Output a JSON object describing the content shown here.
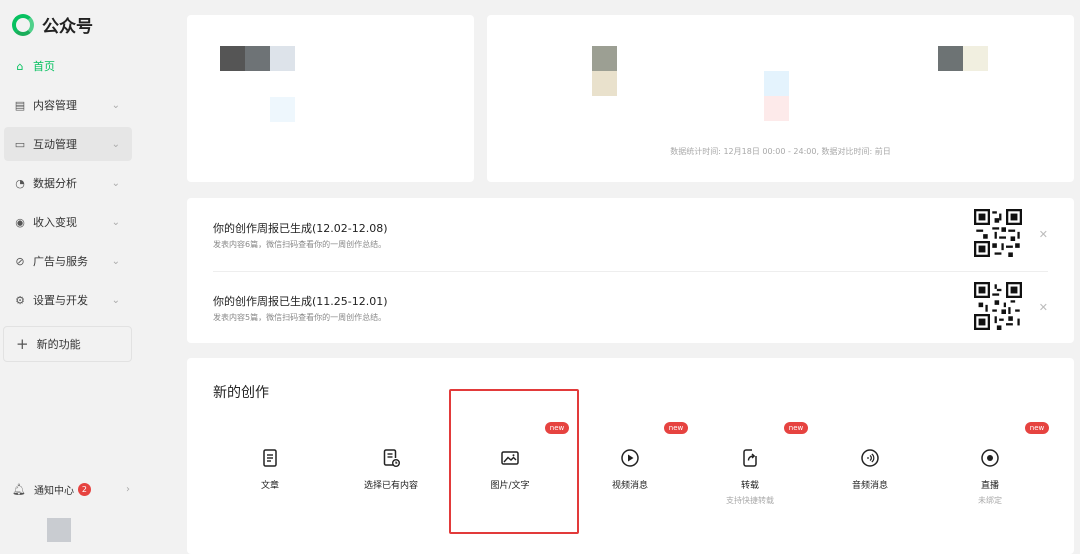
{
  "app": {
    "title": "公众号"
  },
  "sidebar": {
    "items": [
      {
        "label": "首页",
        "icon": "home-icon"
      },
      {
        "label": "内容管理",
        "icon": "document-icon"
      },
      {
        "label": "互动管理",
        "icon": "chat-icon"
      },
      {
        "label": "数据分析",
        "icon": "pie-chart-icon"
      },
      {
        "label": "收入变现",
        "icon": "coin-icon"
      },
      {
        "label": "广告与服务",
        "icon": "compass-icon"
      },
      {
        "label": "设置与开发",
        "icon": "gear-icon"
      }
    ],
    "new_features": "新的功能",
    "notifications": {
      "label": "通知中心",
      "count": "2"
    }
  },
  "stats": {
    "note": "数据统计时间: 12月18日 00:00 - 24:00, 数据对比时间: 前日"
  },
  "reports": [
    {
      "title": "你的创作周报已生成(12.02-12.08)",
      "desc": "发表内容6篇，微信扫码查看你的一周创作总结。"
    },
    {
      "title": "你的创作周报已生成(11.25-12.01)",
      "desc": "发表内容5篇，微信扫码查看你的一周创作总结。"
    }
  ],
  "create": {
    "title": "新的创作",
    "items": [
      {
        "label": "文章",
        "sub": "",
        "icon": "article-icon",
        "new": false
      },
      {
        "label": "选择已有内容",
        "sub": "",
        "icon": "existing-content-icon",
        "new": false
      },
      {
        "label": "图片/文字",
        "sub": "",
        "icon": "image-icon",
        "new": true
      },
      {
        "label": "视频消息",
        "sub": "",
        "icon": "play-icon",
        "new": true
      },
      {
        "label": "转载",
        "sub": "支持快捷转载",
        "icon": "repost-icon",
        "new": true
      },
      {
        "label": "音频消息",
        "sub": "",
        "icon": "audio-icon",
        "new": false
      },
      {
        "label": "直播",
        "sub": "未绑定",
        "icon": "live-icon",
        "new": true
      }
    ],
    "new_badge": "new"
  },
  "colors": {
    "brand": "#07c160",
    "badge": "#e64340",
    "highlight": "#e23a3a"
  }
}
